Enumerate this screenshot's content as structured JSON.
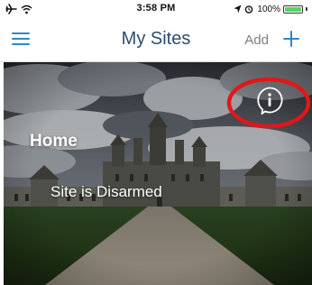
{
  "status_bar": {
    "time": "3:58 PM",
    "battery_percent": "100%",
    "left_icons": [
      "airplane-icon",
      "wifi-icon"
    ],
    "right_icons": [
      "location-arrow-icon",
      "alarm-icon",
      "battery-icon"
    ],
    "battery_color": "#4cd964"
  },
  "nav": {
    "title": "My Sites",
    "add_label": "Add",
    "menu_icon": "hamburger-menu-icon",
    "add_icon": "plus-icon",
    "accent_color": "#2f86c8"
  },
  "sites": [
    {
      "name": "Home",
      "status": "Site is Disarmed",
      "info_icon": "info-icon",
      "annotation": "red-circle-highlight"
    }
  ]
}
